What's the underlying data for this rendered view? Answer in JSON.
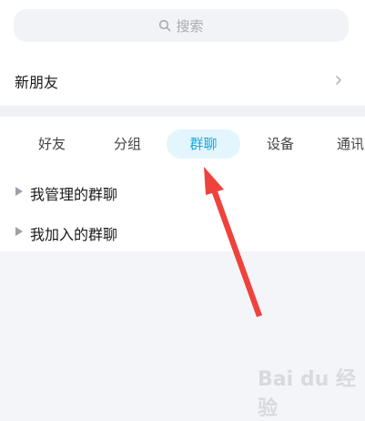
{
  "search": {
    "placeholder": "搜索"
  },
  "new_friends": {
    "label": "新朋友"
  },
  "tabs": [
    {
      "label": "好友",
      "active": false
    },
    {
      "label": "分组",
      "active": false
    },
    {
      "label": "群聊",
      "active": true
    },
    {
      "label": "设备",
      "active": false
    },
    {
      "label": "通讯",
      "active": false
    }
  ],
  "groups": [
    {
      "label": "我管理的群聊"
    },
    {
      "label": "我加入的群聊"
    }
  ],
  "watermark": {
    "text": "Bai du 经验"
  },
  "colors": {
    "accent": "#1aa7e3",
    "tab_active_bg": "#e3f6fd",
    "annotation_arrow": "#f0423d"
  }
}
